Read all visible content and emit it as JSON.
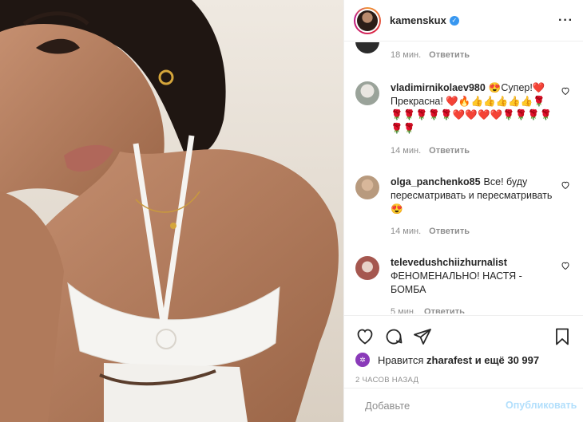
{
  "post": {
    "author": "kamenskux",
    "more_icon": "more-horizontal-icon"
  },
  "comments": [
    {
      "user": "",
      "text": "",
      "time": "18 мин.",
      "reply": "Ответить",
      "avatar_color": "#2b2b2b"
    },
    {
      "user": "vladimirnikolaev980",
      "text": "😍Супер!❤️Прекрасна! ❤️🔥👍👍👍👍👍🌹🌹🌹🌹🌹🌹❤️❤️❤️❤️🌹🌹🌹🌹🌹🌹",
      "time": "14 мин.",
      "reply": "Ответить",
      "avatar_color": "#9aa39a"
    },
    {
      "user": "olga_panchenko85",
      "text": "Все!  буду пересматривать и пересматривать 😍",
      "time": "14 мин.",
      "reply": "Ответить",
      "avatar_color": "#b89a7e"
    },
    {
      "user": "televedushchiizhurnalist",
      "text": "ФЕНОМЕНАЛЬНО! НАСТЯ - БОМБА",
      "time": "5 мин.",
      "reply": "Ответить",
      "avatar_color": "#a5574f"
    }
  ],
  "actions": {
    "like_icon": "heart-icon",
    "comment_icon": "comment-icon",
    "share_icon": "share-icon",
    "save_icon": "bookmark-icon"
  },
  "likes": {
    "prefix": "Нравится",
    "user": "zharafest",
    "suffix": "и ещё 30 997"
  },
  "timeago": "2 ЧАСОВ НАЗАД",
  "add_comment": {
    "placeholder": "Добавьте",
    "publish_label": "Опубликовать"
  },
  "colors": {
    "accent": "#3897f0",
    "publish_disabled": "#b2dffc",
    "muted": "#8e8e8e"
  }
}
